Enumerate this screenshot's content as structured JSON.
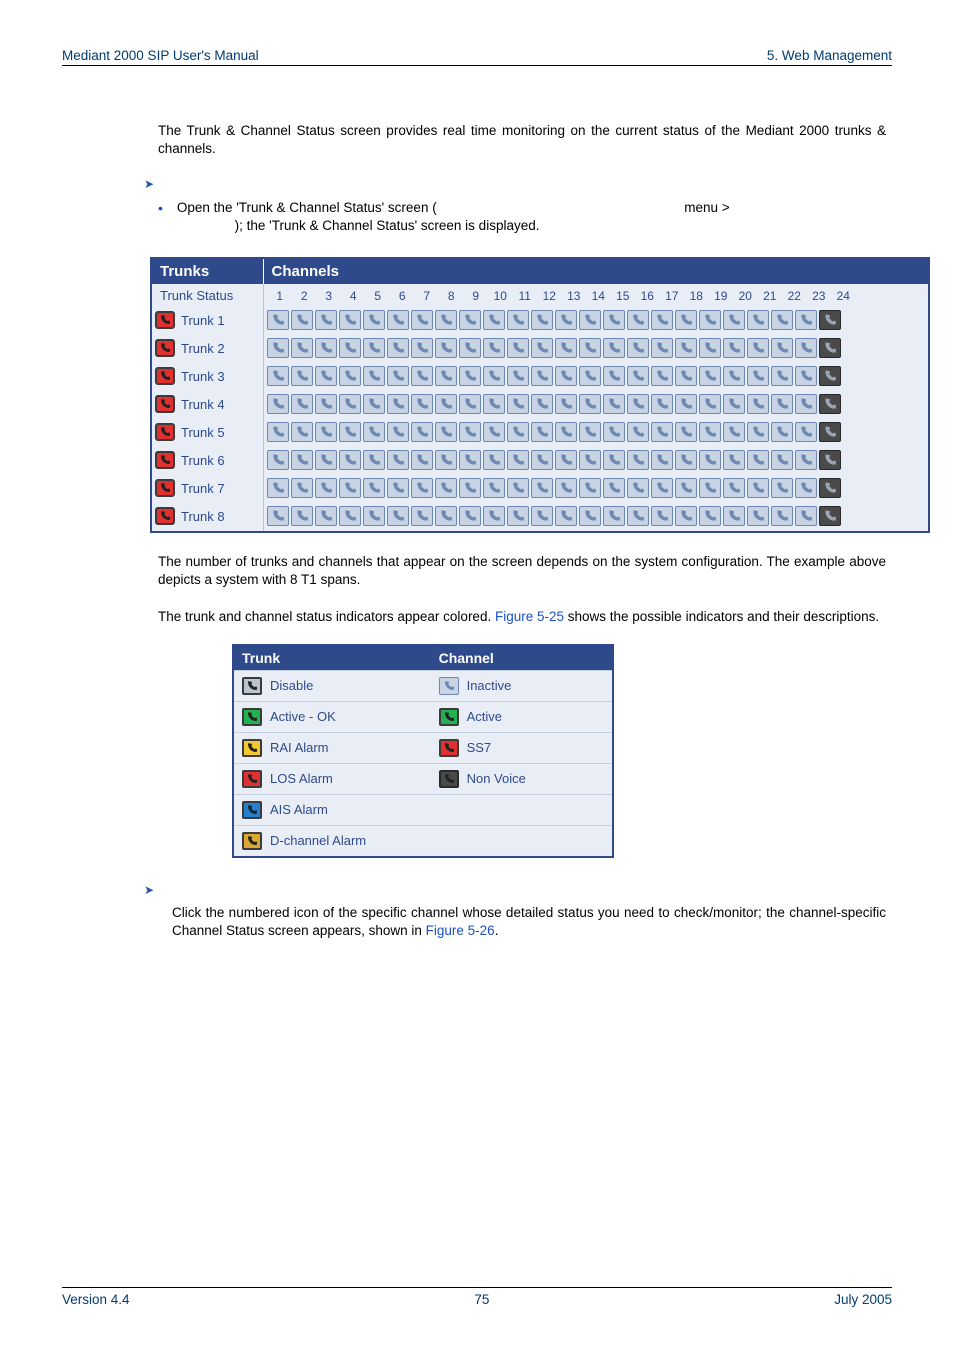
{
  "header": {
    "left": "Mediant 2000 SIP User's Manual",
    "right": "5. Web Management"
  },
  "content": {
    "p1": "The Trunk & Channel Status screen provides real time monitoring on the current status of the Mediant 2000 trunks & channels.",
    "bullet1a": "Open  the  'Trunk  &  Channel  Status'  screen  (",
    "bullet1b": "menu  >",
    "bullet1c": "); the 'Trunk & Channel Status' screen is displayed.",
    "p2": "The number of trunks and channels that appear on the screen depends on the system configuration. The example above depicts a system with 8 T1 spans.",
    "p3a": "The  trunk  and  channel  status  indicators  appear  colored.  ",
    "p3link": "Figure  5-25",
    "p3b": "  shows  the  possible indicators and their descriptions.",
    "p4a": "Click the numbered icon of the specific channel whose detailed status you need to check/monitor; the channel-specific Channel Status screen appears, shown in ",
    "p4link": "Figure 5-26",
    "p4b": "."
  },
  "fig1": {
    "th1": "Trunks",
    "th2": "Channels",
    "sub1": "Trunk Status",
    "channels": [
      "1",
      "2",
      "3",
      "4",
      "5",
      "6",
      "7",
      "8",
      "9",
      "10",
      "11",
      "12",
      "13",
      "14",
      "15",
      "16",
      "17",
      "18",
      "19",
      "20",
      "21",
      "22",
      "23",
      "24"
    ],
    "trunks": [
      "Trunk 1",
      "Trunk 2",
      "Trunk 3",
      "Trunk 4",
      "Trunk 5",
      "Trunk 6",
      "Trunk 7",
      "Trunk 8"
    ]
  },
  "legend": {
    "th_trunk": "Trunk",
    "th_channel": "Channel",
    "trunk_rows": [
      {
        "cls": "lb-gray",
        "label": "Disable"
      },
      {
        "cls": "lb-green",
        "label": "Active - OK"
      },
      {
        "cls": "lb-yellow",
        "label": "RAI Alarm"
      },
      {
        "cls": "lb-red",
        "label": "LOS Alarm"
      },
      {
        "cls": "lb-blue",
        "label": "AIS Alarm"
      },
      {
        "cls": "lb-purple",
        "label": "D-channel Alarm"
      }
    ],
    "channel_rows": [
      {
        "cls": "lb-ch-in",
        "label": "Inactive"
      },
      {
        "cls": "lb-ch-act",
        "label": "Active"
      },
      {
        "cls": "lb-red",
        "label": "SS7"
      },
      {
        "cls": "lb-ch-non",
        "label": "Non Voice"
      }
    ]
  },
  "footer": {
    "left": "Version 4.4",
    "center": "75",
    "right": "July 2005"
  },
  "chart_data": {
    "type": "table",
    "description": "Trunk & Channel Status matrix: 8 trunks × 24 channels",
    "trunk_status": [
      {
        "trunk": "Trunk 1",
        "status": "LOS Alarm",
        "channels": {
          "1-23": "Inactive",
          "24": "Non Voice"
        }
      },
      {
        "trunk": "Trunk 2",
        "status": "LOS Alarm",
        "channels": {
          "1-23": "Inactive",
          "24": "Non Voice"
        }
      },
      {
        "trunk": "Trunk 3",
        "status": "LOS Alarm",
        "channels": {
          "1-23": "Inactive",
          "24": "Non Voice"
        }
      },
      {
        "trunk": "Trunk 4",
        "status": "LOS Alarm",
        "channels": {
          "1-23": "Inactive",
          "24": "Non Voice"
        }
      },
      {
        "trunk": "Trunk 5",
        "status": "LOS Alarm",
        "channels": {
          "1-23": "Inactive",
          "24": "Non Voice"
        }
      },
      {
        "trunk": "Trunk 6",
        "status": "LOS Alarm",
        "channels": {
          "1-23": "Inactive",
          "24": "Non Voice"
        }
      },
      {
        "trunk": "Trunk 7",
        "status": "LOS Alarm",
        "channels": {
          "1-23": "Inactive",
          "24": "Non Voice"
        }
      },
      {
        "trunk": "Trunk 8",
        "status": "LOS Alarm",
        "channels": {
          "1-23": "Inactive",
          "24": "Non Voice"
        }
      }
    ],
    "legend_trunk": {
      "Disable": "gray",
      "Active - OK": "green",
      "RAI Alarm": "yellow",
      "LOS Alarm": "red",
      "AIS Alarm": "blue",
      "D-channel Alarm": "orange"
    },
    "legend_channel": {
      "Inactive": "light",
      "Active": "green",
      "SS7": "red",
      "Non Voice": "dark"
    }
  }
}
